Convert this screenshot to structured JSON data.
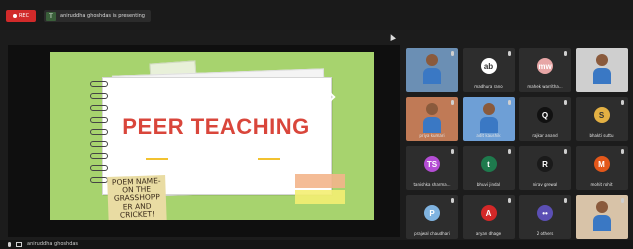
{
  "topbar": {
    "record_label": "REC",
    "share_badge": "T",
    "share_text": "aniruddha ghoshdas is presenting"
  },
  "slide": {
    "title": "PEER TEACHING",
    "sticky_note": "POEM NAME- ON THE GRASSHOPP ER AND CRICKET!"
  },
  "participants": [
    {
      "name": "",
      "type": "video",
      "avatar": "",
      "color": "#6b8fb4"
    },
    {
      "name": "madhura rano",
      "type": "avatar",
      "avatar": "ab",
      "color": "#ffffff"
    },
    {
      "name": "mahek warritha...",
      "type": "avatar",
      "avatar": "mw",
      "color": "#e7a6a6"
    },
    {
      "name": "",
      "type": "video",
      "avatar": "",
      "color": "#cfcfcf"
    },
    {
      "name": "priya kumari",
      "type": "video",
      "avatar": "",
      "color": "#c07a56"
    },
    {
      "name": "adit kaushik",
      "type": "video",
      "avatar": "",
      "color": "#6e9fd6"
    },
    {
      "name": "rajkar anand",
      "type": "avatar",
      "avatar": "Q",
      "color": "#111111"
    },
    {
      "name": "bhakti suttu",
      "type": "avatar",
      "avatar": "S",
      "color": "#e3b043"
    },
    {
      "name": "tanishka sharma...",
      "type": "avatar",
      "avatar": "TS",
      "color": "#b44dd4"
    },
    {
      "name": "bhuvi jindal",
      "type": "avatar",
      "avatar": "t",
      "color": "#1e7a4d"
    },
    {
      "name": "nirav grewal",
      "type": "avatar",
      "avatar": "R",
      "color": "#1a1a1a"
    },
    {
      "name": "mohit rohit",
      "type": "avatar",
      "avatar": "M",
      "color": "#e3571a"
    },
    {
      "name": "prajwal chaudhari",
      "type": "avatar",
      "avatar": "P",
      "color": "#7fb3e0"
    },
    {
      "name": "aryan dhage",
      "type": "avatar",
      "avatar": "A",
      "color": "#d42828"
    },
    {
      "name": "2 others",
      "type": "avatar",
      "avatar": "••",
      "color": "#5b4fb4"
    },
    {
      "name": "",
      "type": "video",
      "avatar": "",
      "color": "#d8c3a8"
    }
  ],
  "bottombar": {
    "self_name": "aniruddha ghoshdas"
  }
}
